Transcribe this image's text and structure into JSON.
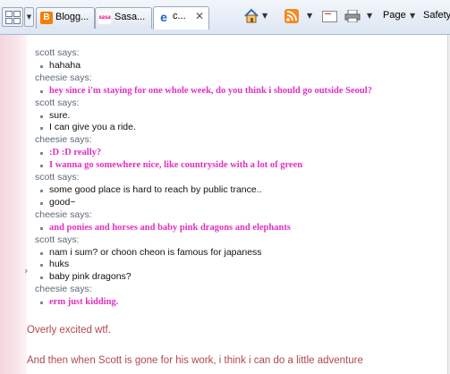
{
  "toolbar": {
    "tabs": [
      {
        "label": "Blogg...",
        "icon": "blogger-icon"
      },
      {
        "label": "Sasa...",
        "icon": "sasa-icon"
      },
      {
        "label": "c...",
        "icon": "ie-icon",
        "active": true
      }
    ],
    "sasa_logo_text": "sasa",
    "blogger_logo_text": "B",
    "close_glyph": "✕",
    "page_menu": "Page",
    "safety_menu": "Safety",
    "dropdown_glyph": "▼",
    "icons": [
      "quick-tabs-icon",
      "tab-list-icon",
      "home-icon",
      "feeds-icon",
      "read-mail-icon",
      "print-icon"
    ]
  },
  "conversation": [
    {
      "speaker": "scott says:",
      "style": "normal",
      "messages": [
        "hahaha"
      ]
    },
    {
      "speaker": "cheesie says:",
      "style": "pink",
      "messages": [
        "hey since i'm staying for one whole week, do you think i should go outside Seoul?"
      ]
    },
    {
      "speaker": "scott says:",
      "style": "normal",
      "messages": [
        "sure.",
        "I can give you a ride."
      ]
    },
    {
      "speaker": "cheesie says:",
      "style": "pink",
      "messages": [
        ":D :D really?",
        "I wanna go somewhere nice, like countryside with a lot of green"
      ]
    },
    {
      "speaker": "scott says:",
      "style": "normal",
      "messages": [
        "some good place is hard to reach by public trance..",
        "good~"
      ]
    },
    {
      "speaker": "cheesie says:",
      "style": "pink",
      "messages": [
        "and ponies and horses and baby pink dragons and elephants"
      ]
    },
    {
      "speaker": "scott says:",
      "style": "normal",
      "messages": [
        "nam i sum? or choon cheon is famous for japaness",
        "huks",
        "baby pink dragons?"
      ]
    },
    {
      "speaker": "cheesie says:",
      "style": "pink",
      "messages": [
        "erm just kidding."
      ]
    }
  ],
  "body_text": {
    "paragraph1": "Overly excited wtf.",
    "paragraph2": "And then when Scott is gone for his work, i think i can do a little adventure"
  },
  "side_arrow": "›",
  "colors": {
    "speaker": "#5d6a78",
    "pink_message": "#e02fc0",
    "body_text": "#b2474b",
    "left_decoration": "#f3d7de"
  }
}
